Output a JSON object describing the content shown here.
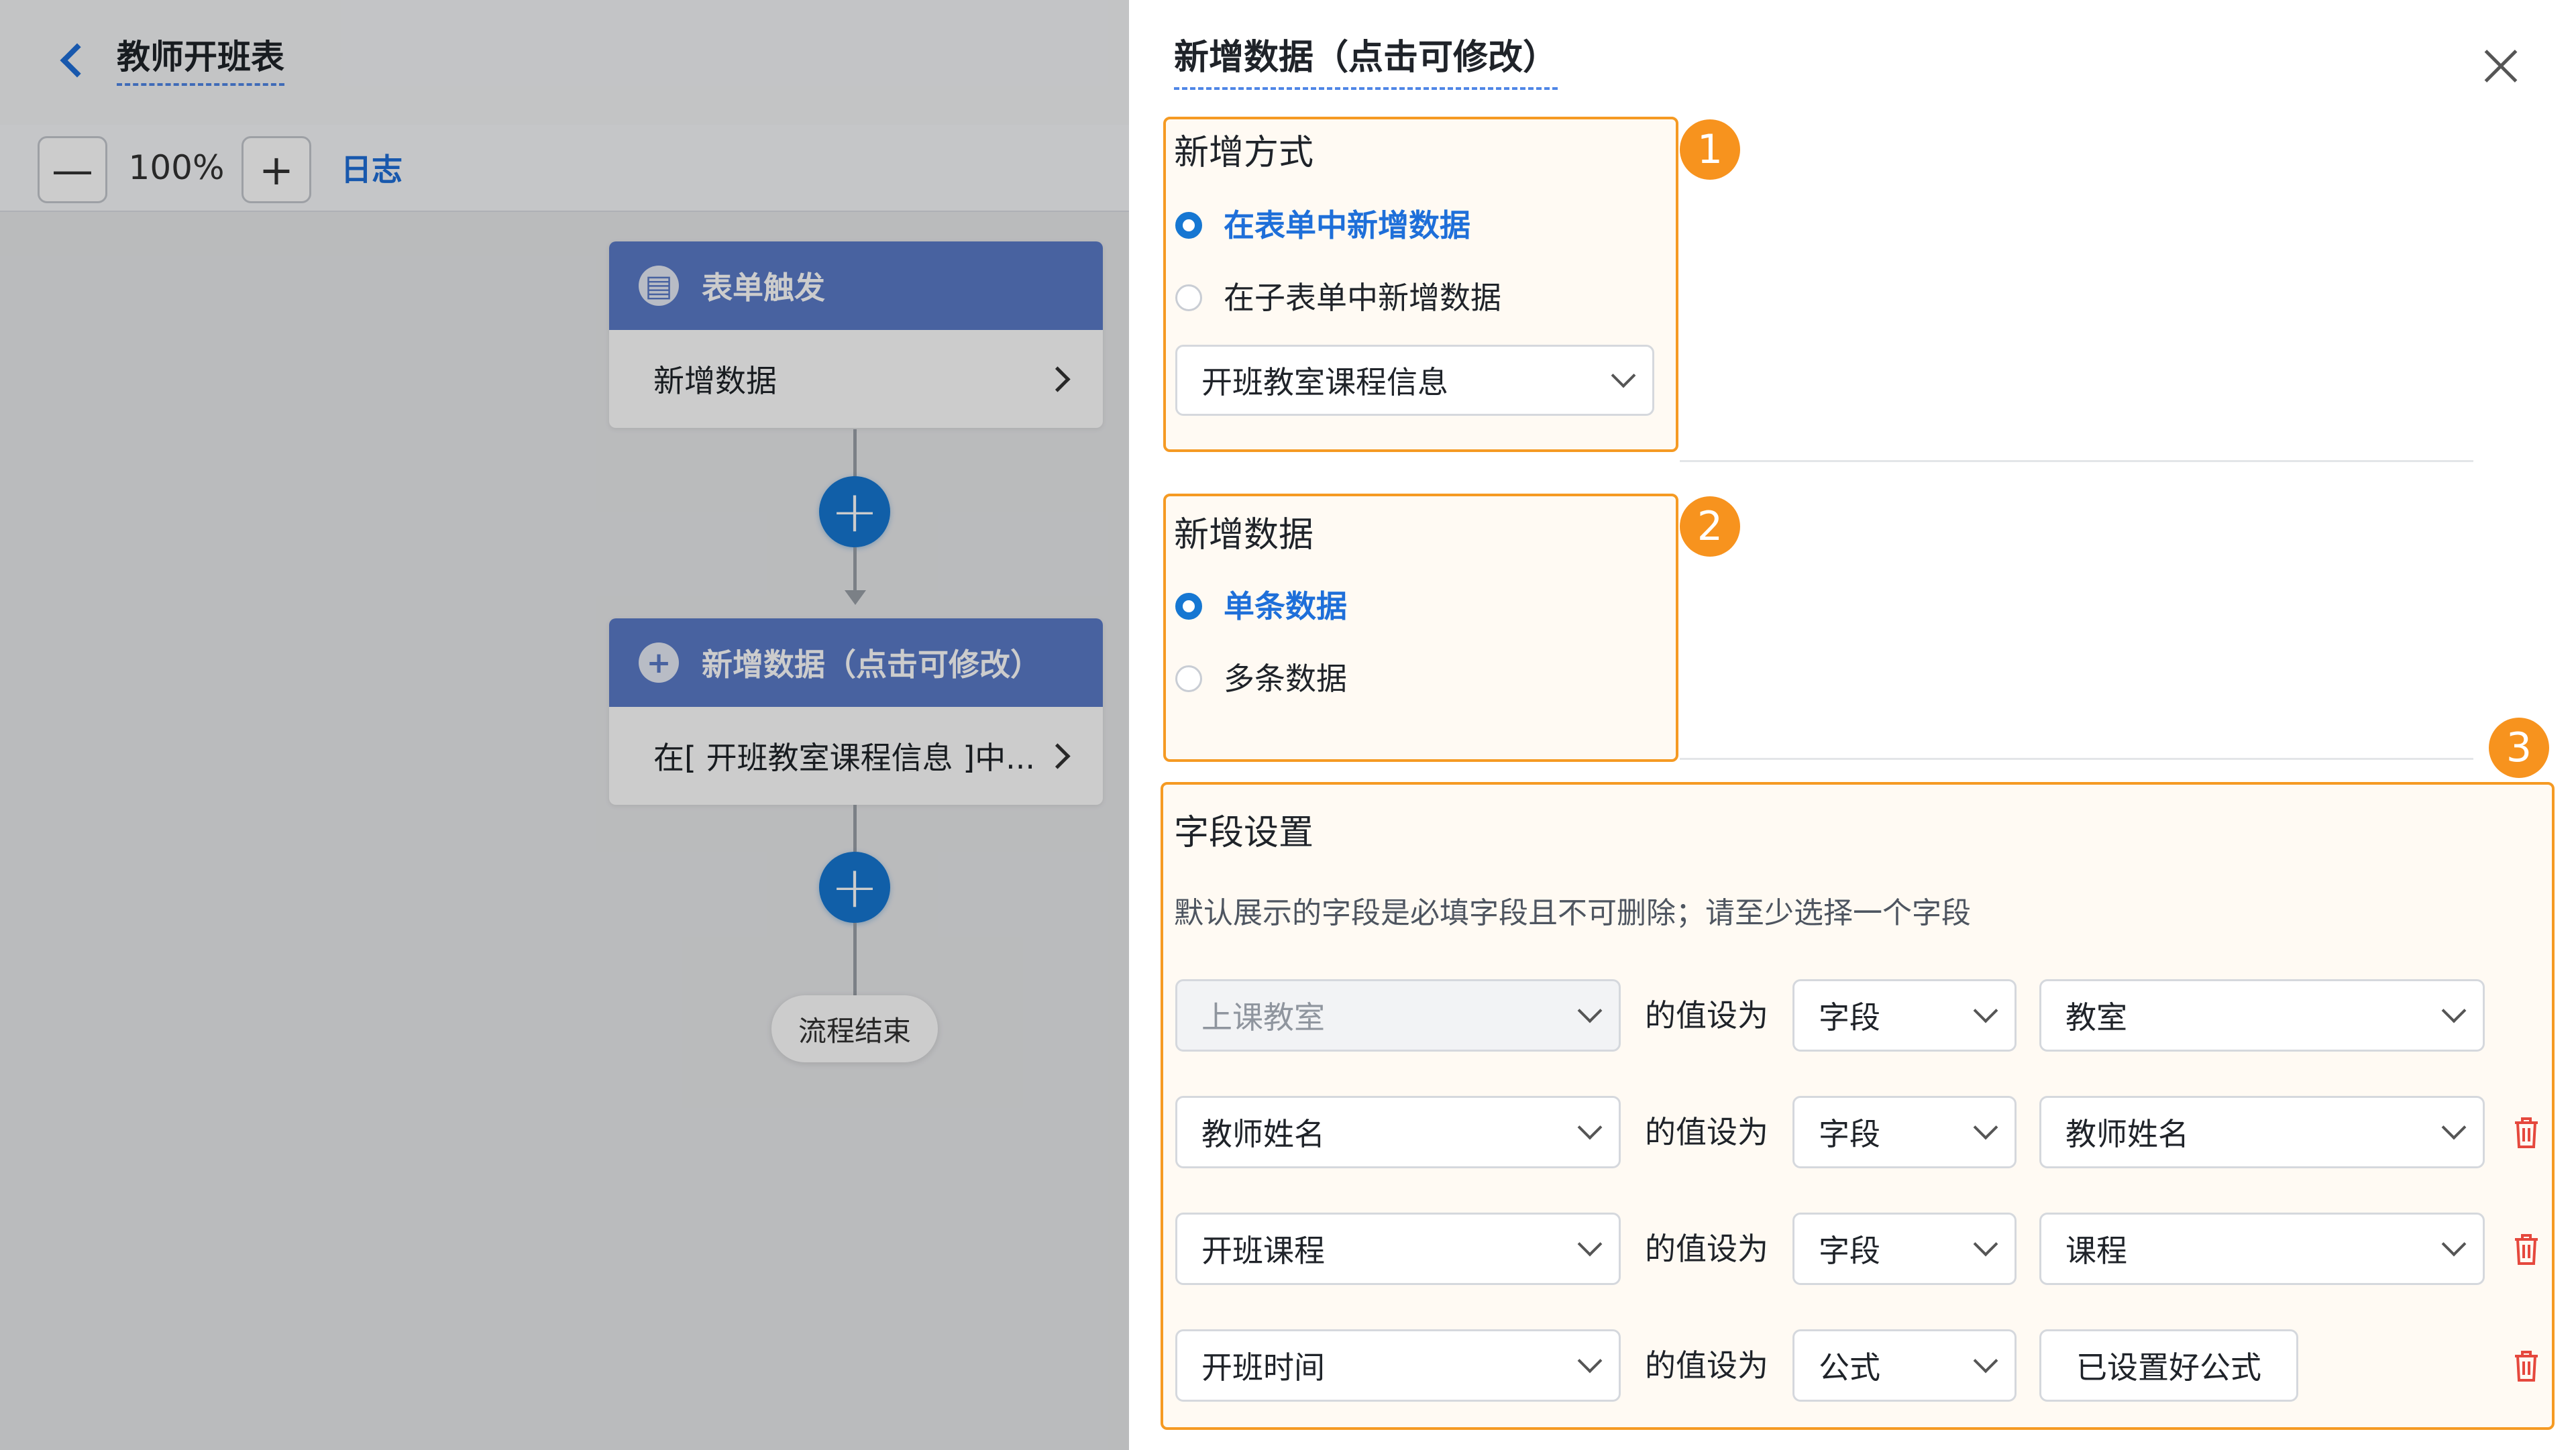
{
  "header": {
    "title": "教师开班表"
  },
  "toolbar": {
    "zoom": "100%",
    "zoom_out": "—",
    "zoom_in": "+",
    "log_label": "日志"
  },
  "flow": {
    "node1": {
      "header": "表单触发",
      "icon": "document-icon",
      "body": "新增数据"
    },
    "node2": {
      "header": "新增数据（点击可修改）",
      "icon": "plus-icon",
      "body": "在[ 开班教室课程信息 ]中..."
    },
    "add_button": "+",
    "end_label": "流程结束"
  },
  "panel": {
    "title": "新增数据（点击可修改）",
    "section1": {
      "badge": "1",
      "title": "新增方式",
      "options": [
        "在表单中新增数据",
        "在子表单中新增数据"
      ],
      "selected_index": 0,
      "form_select": "开班教室课程信息"
    },
    "section2": {
      "badge": "2",
      "title": "新增数据",
      "options": [
        "单条数据",
        "多条数据"
      ],
      "selected_index": 0
    },
    "section3": {
      "badge": "3",
      "title": "字段设置",
      "hint": "默认展示的字段是必填字段且不可删除；请至少选择一个字段",
      "set_to_label": "的值设为",
      "rows": [
        {
          "field": "上课教室",
          "field_disabled": true,
          "mode": "字段",
          "value": "教室",
          "deletable": false
        },
        {
          "field": "教师姓名",
          "field_disabled": false,
          "mode": "字段",
          "value": "教师姓名",
          "deletable": true
        },
        {
          "field": "开班课程",
          "field_disabled": false,
          "mode": "字段",
          "value": "课程",
          "deletable": true
        },
        {
          "field": "开班时间",
          "field_disabled": false,
          "mode": "公式",
          "value": "已设置好公式",
          "value_is_button": true,
          "deletable": true
        }
      ]
    }
  },
  "colors": {
    "accent": "#1677d2",
    "node_header": "#5b7bc8",
    "highlight": "#f59a23",
    "delete": "#e5483d"
  }
}
